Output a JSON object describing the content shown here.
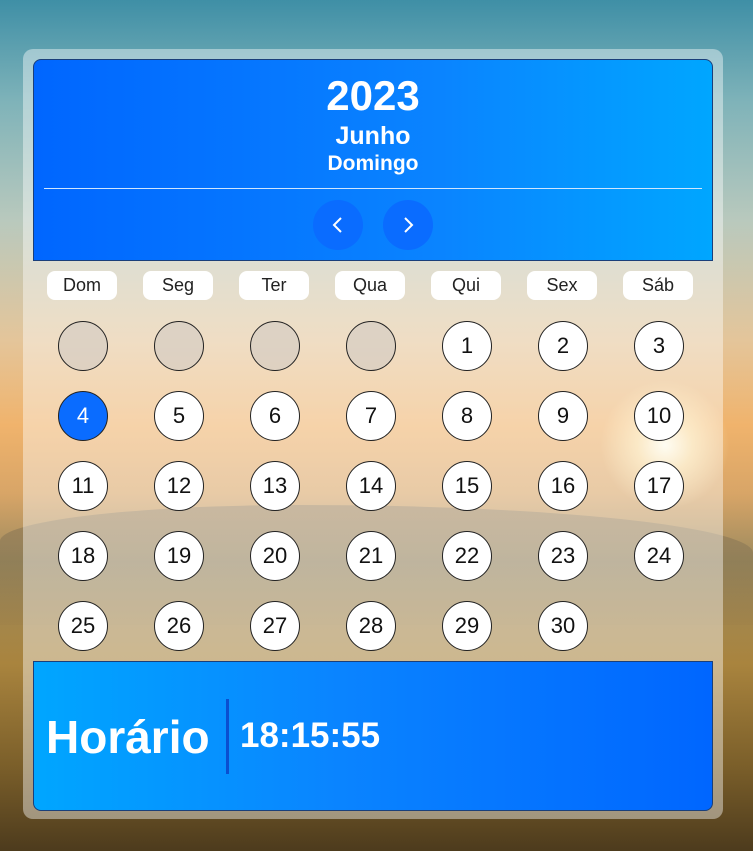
{
  "calendar": {
    "year": "2023",
    "month": "Junho",
    "weekday": "Domingo"
  },
  "navigation": {
    "prev_icon": "chevron-left-icon",
    "next_icon": "chevron-right-icon"
  },
  "weekdays": [
    "Dom",
    "Seg",
    "Ter",
    "Qua",
    "Qui",
    "Sex",
    "Sáb"
  ],
  "days": {
    "leading_empty": 4,
    "numbers": [
      "1",
      "2",
      "3",
      "4",
      "5",
      "6",
      "7",
      "8",
      "9",
      "10",
      "11",
      "12",
      "13",
      "14",
      "15",
      "16",
      "17",
      "18",
      "19",
      "20",
      "21",
      "22",
      "23",
      "24",
      "25",
      "26",
      "27",
      "28",
      "29",
      "30"
    ],
    "selected": "4"
  },
  "footer": {
    "label": "Horário",
    "time": "18:15:55"
  },
  "colors": {
    "accent": "#0a6cff",
    "header_gradient_end": "#00a6ff"
  }
}
